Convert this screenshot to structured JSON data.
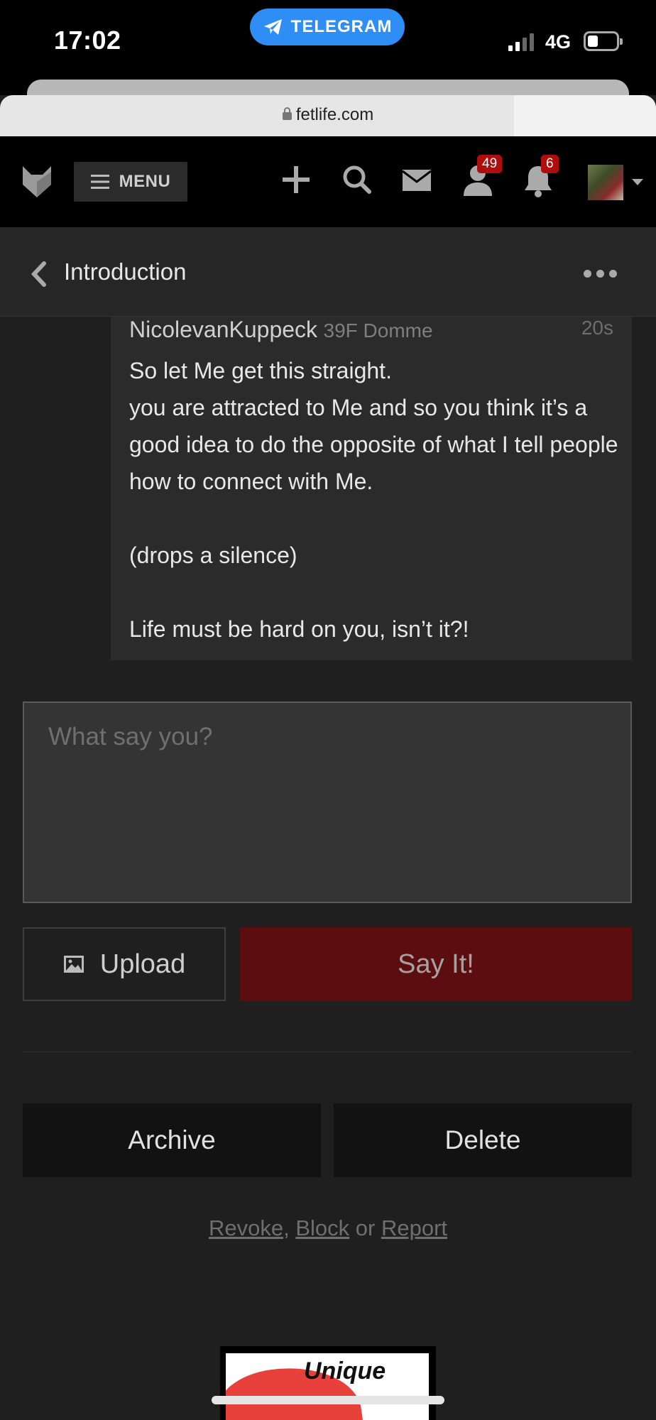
{
  "status_bar": {
    "time": "17:02",
    "telegram_label": "TELEGRAM",
    "network": "4G"
  },
  "browser": {
    "url": "fetlife.com"
  },
  "navbar": {
    "menu_label": "MENU",
    "friends_badge": "49",
    "notifications_badge": "6"
  },
  "header": {
    "title": "Introduction"
  },
  "message": {
    "author": "NicolevanKuppeck",
    "meta": "39F Domme",
    "time": "20s",
    "lines": [
      "So let Me get this straight.",
      "you are attracted to Me and so you think it’s a good idea to do the opposite of what I tell people how to connect with Me.",
      "(drops a silence)",
      "Life must be hard on you, isn’t it?!"
    ]
  },
  "reply": {
    "placeholder": "What say you?",
    "upload_label": "Upload",
    "submit_label": "Say It!"
  },
  "actions": {
    "archive_label": "Archive",
    "delete_label": "Delete"
  },
  "links": {
    "revoke": "Revoke",
    "block": "Block",
    "or": "or",
    "report": "Report",
    "comma": ","
  },
  "ad": {
    "text": "Unique"
  },
  "colors": {
    "accent_red": "#5c0d0f",
    "badge_red": "#b00d0d",
    "telegram_blue": "#2f8ef5"
  }
}
